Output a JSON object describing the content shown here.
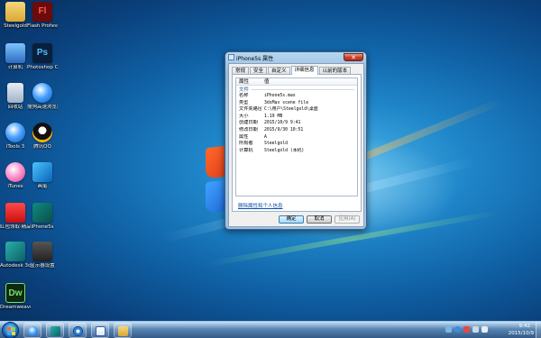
{
  "desktop": {
    "icons": [
      {
        "label": "Steelgold",
        "icon": "folder-icon"
      },
      {
        "label": "Flash Professio...",
        "icon": "flash-icon",
        "glyph": "Fl"
      },
      {
        "label": "计算机",
        "icon": "computer-icon"
      },
      {
        "label": "Photoshop CS6 (64 Bit)",
        "icon": "photoshop-icon",
        "glyph": "Ps"
      },
      {
        "label": "回收站",
        "icon": "recycle-bin-icon"
      },
      {
        "label": "搜狗高速浏览器",
        "icon": "sogou-browser-icon"
      },
      {
        "label": "iTools 3",
        "icon": "itools-icon"
      },
      {
        "label": "腾讯QQ",
        "icon": "qq-icon"
      },
      {
        "label": "iTunes",
        "icon": "itunes-icon"
      },
      {
        "label": "画笔",
        "icon": "pen-icon"
      },
      {
        "label": "红包领取·精品",
        "icon": "gift-icon"
      },
      {
        "label": "iPhone5s",
        "icon": "3dsmax-file-icon"
      },
      {
        "label": "Autodesk 3ds Max",
        "icon": "autodesk-icon"
      },
      {
        "label": "显示器设置",
        "icon": "monitor-app-icon"
      },
      {
        "label": "Dreamweaver CS6",
        "icon": "dreamweaver-icon",
        "glyph": "Dw"
      }
    ]
  },
  "dialog": {
    "title": "iPhone5s 属性",
    "close_label": "✕",
    "tabs": [
      {
        "label": "常规",
        "active": false
      },
      {
        "label": "安全",
        "active": false
      },
      {
        "label": "自定义",
        "active": false
      },
      {
        "label": "详细信息",
        "active": true
      },
      {
        "label": "以前的版本",
        "active": false
      }
    ],
    "list_header": {
      "property": "属性",
      "value": "值"
    },
    "group_label": "文件",
    "rows": [
      {
        "name": "名称",
        "value": "iPhone5s.max"
      },
      {
        "name": "类型",
        "value": "3dsMax scene file"
      },
      {
        "name": "文件夹路径",
        "value": "C:\\用户\\Steelgold\\桌面"
      },
      {
        "name": "大小",
        "value": "1.19 MB"
      },
      {
        "name": "创建日期",
        "value": "2015/10/9 9:41"
      },
      {
        "name": "修改日期",
        "value": "2015/9/30 10:51"
      },
      {
        "name": "属性",
        "value": "A"
      },
      {
        "name": "所有者",
        "value": "Steelgold"
      },
      {
        "name": "计算机",
        "value": "Steelgold (本机)"
      }
    ],
    "remove_link": "删除属性和个人信息",
    "buttons": {
      "ok": "确定",
      "cancel": "取消",
      "apply": "应用(A)"
    }
  },
  "taskbar": {
    "items": [
      {
        "icon": "sogou-browser-icon"
      },
      {
        "icon": "3dsmax-icon"
      },
      {
        "icon": "media-player-icon"
      },
      {
        "icon": "baidu-icon"
      },
      {
        "icon": "file-explorer-icon"
      }
    ],
    "clock_time": "9:42",
    "clock_date": "2015/10/9"
  },
  "colors": {
    "accent": "#1f86c9",
    "link": "#0a4fb0",
    "close": "#c7452f"
  }
}
